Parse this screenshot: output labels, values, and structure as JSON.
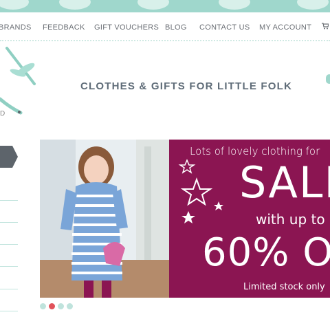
{
  "nav": {
    "items": [
      "BRANDS",
      "FEEDBACK",
      "GIFT VOUCHERS",
      "BLOG",
      "CONTACT US",
      "MY ACCOUNT"
    ],
    "cart_icon": "cart-icon"
  },
  "logo": {
    "partial_text": "D",
    "icon": "dragonfly-icon"
  },
  "tagline": "CLOTHES & GIFTS FOR LITTLE FOLK",
  "slider": {
    "promo": {
      "line1": "Lots of lovely clothing for",
      "line2": "SALE",
      "line3": "with up to",
      "line4": "60% O",
      "line5": "Limited stock only"
    },
    "active_dot": 1,
    "dot_count": 4
  },
  "colors": {
    "accent": "#9fd7cc",
    "promo_bg": "#8b1552",
    "active_dot": "#e0525a",
    "nav_text": "#6b6f75",
    "side_banner": "#5d646b"
  }
}
